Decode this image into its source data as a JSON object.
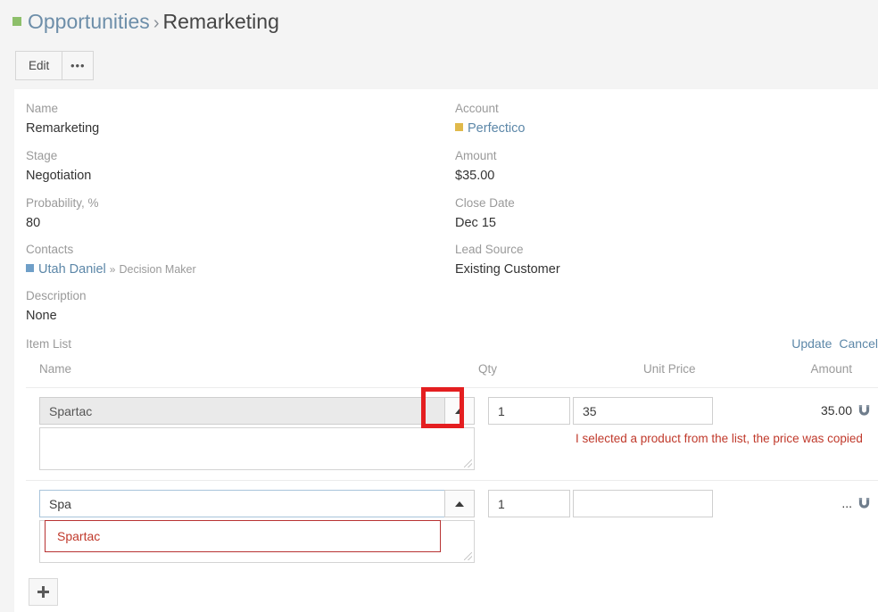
{
  "breadcrumb": {
    "parent": "Opportunities",
    "separator": "›",
    "current": "Remarketing",
    "parent_bullet_color": "#8dbf6a"
  },
  "toolbar": {
    "edit_label": "Edit",
    "more_label": "•••"
  },
  "detail": {
    "left": [
      {
        "label": "Name",
        "value": "Remarketing"
      },
      {
        "label": "Stage",
        "value": "Negotiation"
      },
      {
        "label": "Probability, %",
        "value": "80"
      }
    ],
    "right": [
      {
        "label": "Account",
        "value": "Perfectico",
        "bullet_color": "#e0b94b",
        "is_link": true
      },
      {
        "label": "Amount",
        "value": "$35.00"
      },
      {
        "label": "Close Date",
        "value": "Dec 15"
      },
      {
        "label": "Lead Source",
        "value": "Existing Customer"
      }
    ],
    "contacts": {
      "label": "Contacts",
      "name": "Utah Daniel",
      "separator": "»",
      "role": "Decision Maker",
      "bullet_color": "#6f9fc8"
    },
    "description": {
      "label": "Description",
      "value": "None"
    }
  },
  "item_list": {
    "title": "Item List",
    "update_label": "Update",
    "cancel_label": "Cancel",
    "columns": {
      "name": "Name",
      "qty": "Qty",
      "unit_price": "Unit Price",
      "amount": "Amount"
    },
    "rows": [
      {
        "name_value": "Spartac",
        "name_placeholder": "",
        "description_value": "",
        "qty": "1",
        "unit_price": "35",
        "amount": "35.00",
        "note": "I selected a product from the list, the price was copied",
        "magnet_icon": "magnet-icon",
        "remove_icon": "✖"
      },
      {
        "name_value": "Spa",
        "name_placeholder": "",
        "description_value": "",
        "qty": "1",
        "unit_price": "",
        "amount": "...",
        "note": "",
        "magnet_icon": "magnet-icon",
        "remove_icon": "✖",
        "autocomplete": {
          "options": [
            "Spartac"
          ]
        }
      }
    ],
    "add_button_label": "+"
  },
  "annotation": {
    "highlight_color": "#e41e20",
    "note_color": "#c0392b"
  }
}
